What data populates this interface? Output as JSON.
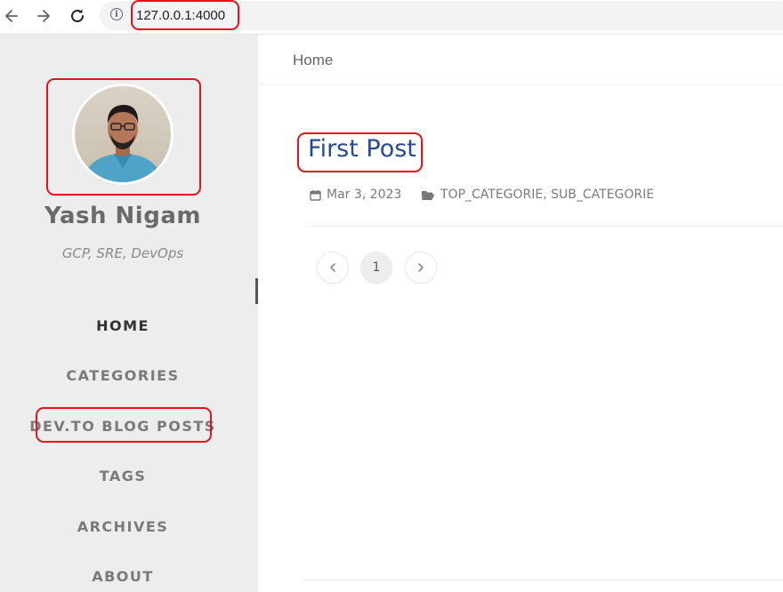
{
  "browser": {
    "url": "127.0.0.1:4000"
  },
  "sidebar": {
    "site_title": "Yash Nigam",
    "subtitle": "GCP, SRE, DevOps",
    "nav": [
      {
        "label": "HOME",
        "active": true
      },
      {
        "label": "CATEGORIES"
      },
      {
        "label": "DEV.TO BLOG POSTS"
      },
      {
        "label": "TAGS"
      },
      {
        "label": "ARCHIVES"
      },
      {
        "label": "ABOUT"
      }
    ]
  },
  "topbar": {
    "breadcrumb": "Home"
  },
  "post": {
    "title": "First Post",
    "date": "Mar 3, 2023",
    "categories": "TOP_CATEGORIE, SUB_CATEGORIE"
  },
  "pagination": {
    "current_page": "1"
  },
  "colors": {
    "accent_link": "#2a4a92",
    "sidebar_bg": "#ededed",
    "annotation_red": "#e0141e"
  }
}
